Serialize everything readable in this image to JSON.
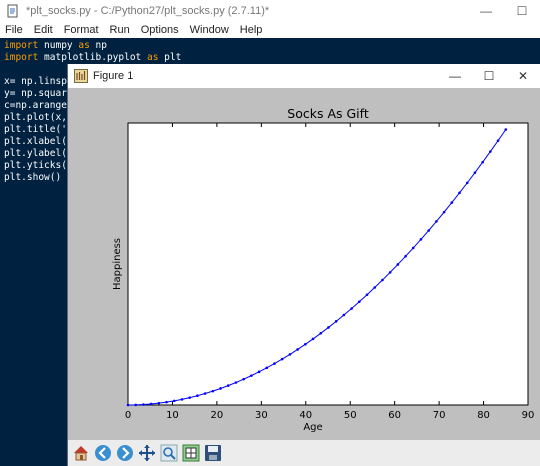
{
  "idle": {
    "title": "*plt_socks.py - C:/Python27/plt_socks.py (2.7.11)*",
    "menu": [
      "File",
      "Edit",
      "Format",
      "Run",
      "Options",
      "Window",
      "Help"
    ],
    "code": [
      {
        "kw": "import",
        "rest": " numpy ",
        "kw2": "as",
        "rest2": " np"
      },
      {
        "kw": "import",
        "rest": " matplotlib.pyplot ",
        "kw2": "as",
        "rest2": " plt"
      },
      {
        "kw": "",
        "rest": "",
        "kw2": "",
        "rest2": ""
      },
      {
        "kw": "",
        "rest": "x= np.linsp",
        "kw2": "",
        "rest2": ""
      },
      {
        "kw": "",
        "rest": "y= np.squar",
        "kw2": "",
        "rest2": ""
      },
      {
        "kw": "",
        "rest": "c=np.arange",
        "kw2": "",
        "rest2": ""
      },
      {
        "kw": "",
        "rest": "plt.plot(x,",
        "kw2": "",
        "rest2": ""
      },
      {
        "kw": "",
        "rest": "plt.title('",
        "kw2": "",
        "rest2": ""
      },
      {
        "kw": "",
        "rest": "plt.xlabel(",
        "kw2": "",
        "rest2": ""
      },
      {
        "kw": "",
        "rest": "plt.ylabel(",
        "kw2": "",
        "rest2": ""
      },
      {
        "kw": "",
        "rest": "plt.yticks(",
        "kw2": "",
        "rest2": ""
      },
      {
        "kw": "",
        "rest": "plt.show()",
        "kw2": "",
        "rest2": ""
      }
    ],
    "keyword_color": "#ff9d00",
    "background_color": "#002240"
  },
  "figure": {
    "title": "Figure 1",
    "toolbar_icons": [
      "home-icon",
      "back-icon",
      "forward-icon",
      "pan-icon",
      "zoom-icon",
      "subplots-icon",
      "save-icon"
    ]
  },
  "chart_data": {
    "type": "line",
    "title": "Socks As Gift",
    "xlabel": "Age",
    "ylabel": "Happiness",
    "xlim": [
      0,
      90
    ],
    "xticks": [
      0,
      10,
      20,
      30,
      40,
      50,
      60,
      70,
      80,
      90
    ],
    "yticks": [],
    "ylim": [
      0,
      7396
    ],
    "x": [
      0.0,
      1.735,
      3.469,
      5.204,
      6.939,
      8.673,
      10.408,
      12.143,
      13.878,
      15.612,
      17.347,
      19.082,
      20.816,
      22.551,
      24.286,
      26.02,
      27.755,
      29.49,
      31.224,
      32.959,
      34.694,
      36.429,
      38.163,
      39.898,
      41.633,
      43.367,
      45.102,
      46.837,
      48.571,
      50.306,
      52.041,
      53.776,
      55.51,
      57.245,
      58.98,
      60.714,
      62.449,
      64.184,
      65.918,
      67.653,
      69.388,
      71.122,
      72.857,
      74.592,
      76.327,
      78.061,
      79.796,
      81.531,
      83.265,
      85.0
    ],
    "y": [
      0.0,
      3.0,
      12.0,
      27.1,
      48.1,
      75.2,
      108.3,
      147.4,
      192.6,
      243.7,
      300.9,
      364.1,
      433.3,
      508.5,
      589.8,
      677.1,
      770.4,
      869.7,
      975.0,
      1086.3,
      1203.7,
      1327.0,
      1456.4,
      1591.9,
      1733.3,
      1880.7,
      2034.2,
      2193.7,
      2359.2,
      2530.7,
      2708.3,
      2891.8,
      3081.4,
      3277.0,
      3478.6,
      3686.2,
      3899.9,
      4119.6,
      4345.2,
      4576.9,
      4814.7,
      5058.4,
      5308.2,
      5564.0,
      5825.8,
      6093.7,
      6367.5,
      6647.3,
      6933.2,
      7225.0
    ],
    "series": [
      {
        "color": "#0000ff"
      }
    ],
    "marker": "dot",
    "grid": false,
    "background": "#bfbfbf",
    "axes_background": "#ffffff"
  }
}
